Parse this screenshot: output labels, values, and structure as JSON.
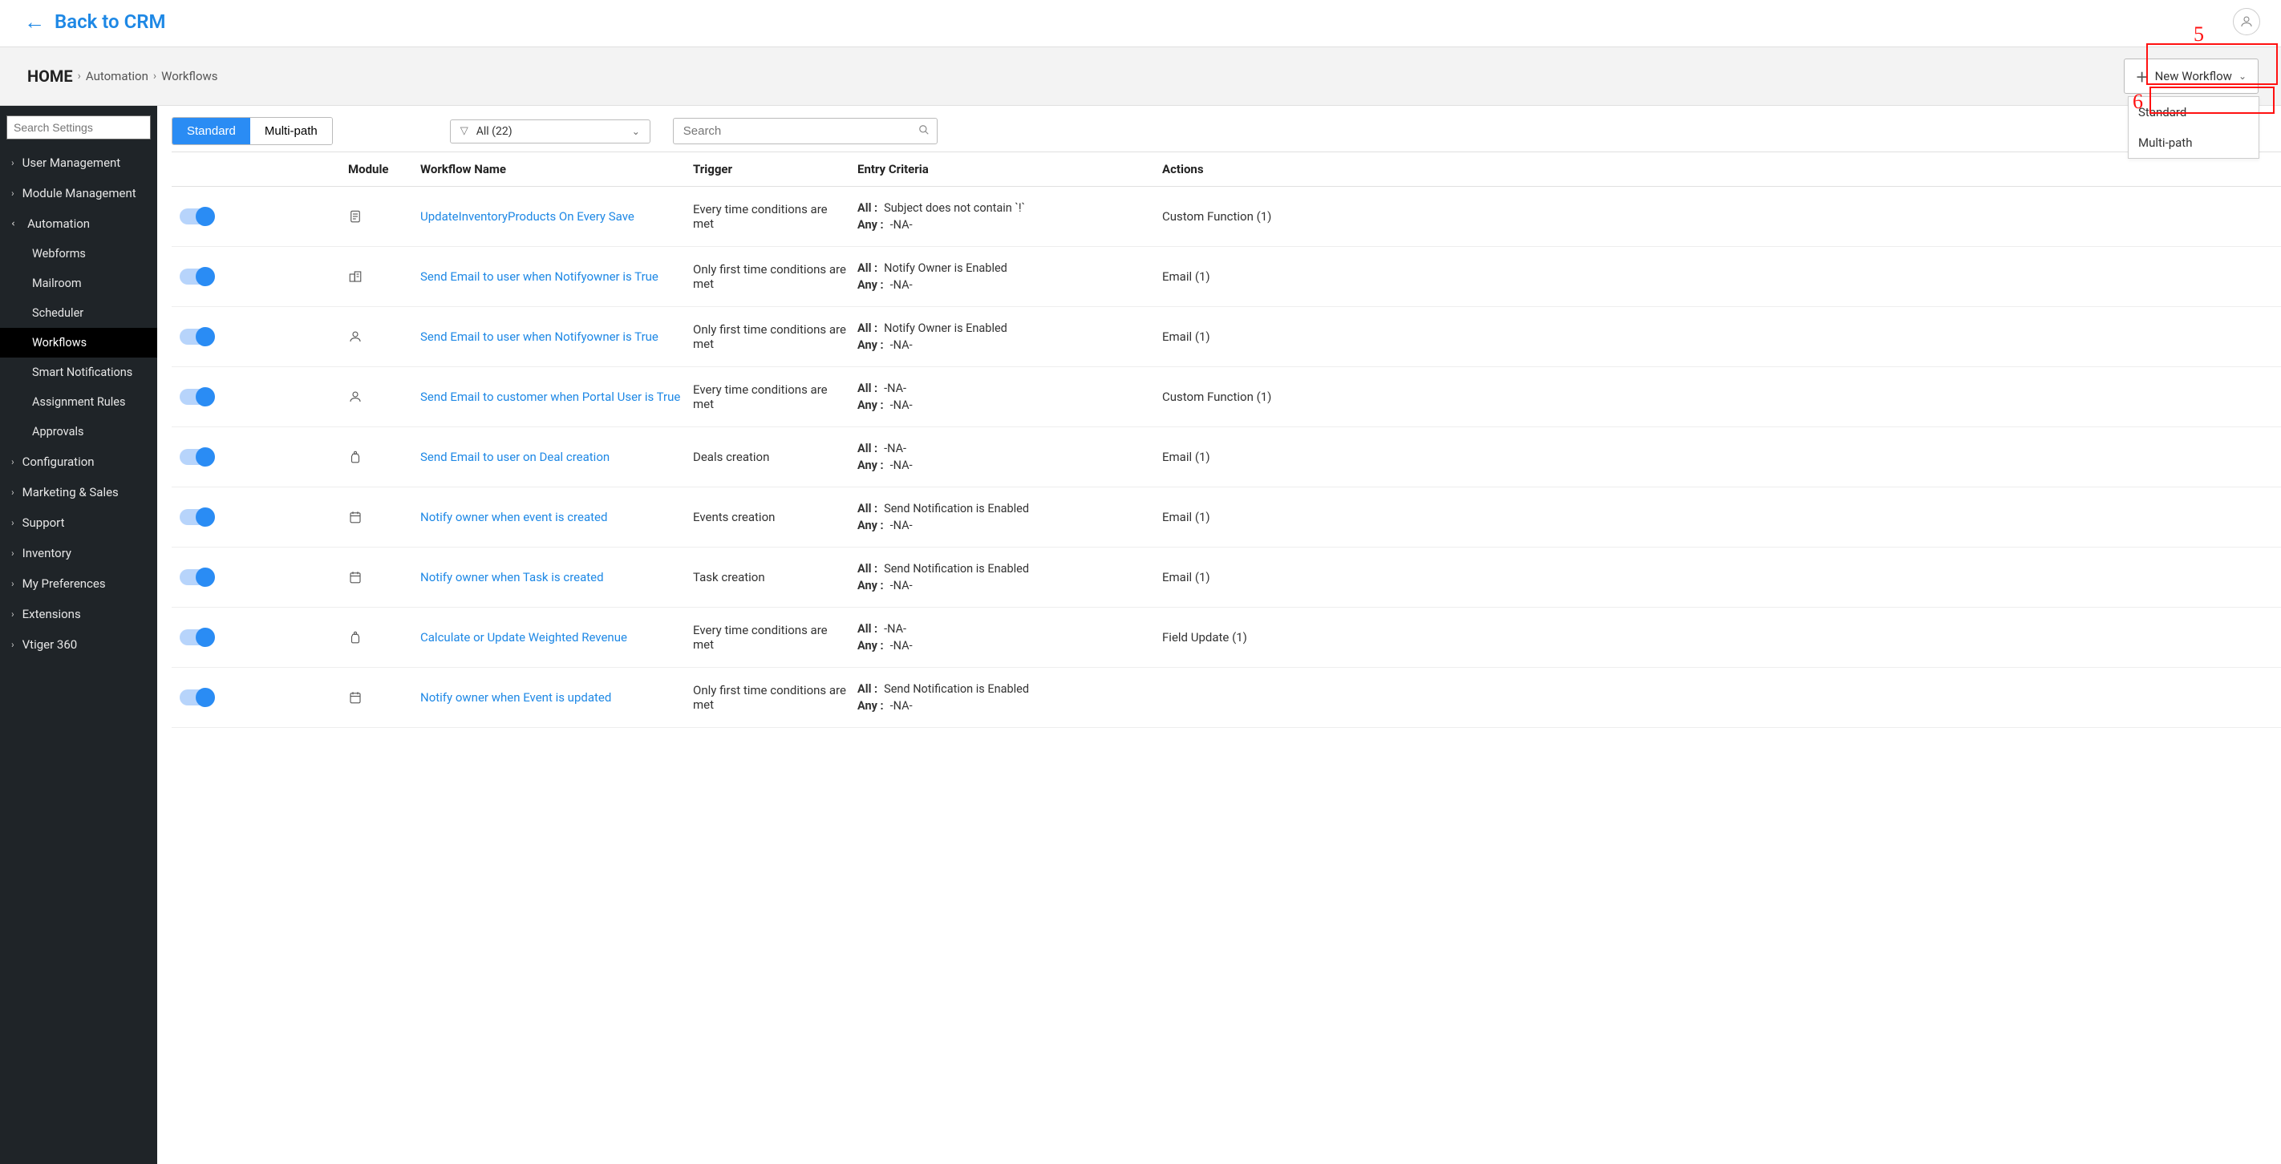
{
  "header": {
    "back_label": "Back to CRM"
  },
  "breadcrumb": {
    "home": "HOME",
    "level1": "Automation",
    "level2": "Workflows"
  },
  "newWorkflow": {
    "label": "New Workflow",
    "menu": {
      "standard": "Standard",
      "multipath": "Multi-path"
    }
  },
  "sidebar": {
    "search_placeholder": "Search Settings",
    "items": [
      {
        "label": "User Management",
        "expanded": false
      },
      {
        "label": "Module Management",
        "expanded": false
      },
      {
        "label": "Automation",
        "expanded": true,
        "children": [
          "Webforms",
          "Mailroom",
          "Scheduler",
          "Workflows",
          "Smart Notifications",
          "Assignment Rules",
          "Approvals"
        ]
      },
      {
        "label": "Configuration",
        "expanded": false
      },
      {
        "label": "Marketing & Sales",
        "expanded": false
      },
      {
        "label": "Support",
        "expanded": false
      },
      {
        "label": "Inventory",
        "expanded": false
      },
      {
        "label": "My Preferences",
        "expanded": false
      },
      {
        "label": "Extensions",
        "expanded": false
      },
      {
        "label": "Vtiger 360",
        "expanded": false
      }
    ],
    "active_child": "Workflows"
  },
  "toolbar": {
    "seg_standard": "Standard",
    "seg_multipath": "Multi-path",
    "filter_label": "All (22)",
    "search_placeholder": "Search"
  },
  "table": {
    "headers": {
      "module": "Module",
      "name": "Workflow Name",
      "trigger": "Trigger",
      "criteria": "Entry Criteria",
      "actions": "Actions"
    },
    "rows": [
      {
        "icon": "doc",
        "name": "UpdateInventoryProducts On Every Save",
        "trigger": "Every time conditions are met",
        "all": "Subject does not contain `!`",
        "any": "-NA-",
        "actions": "Custom Function (1)"
      },
      {
        "icon": "org",
        "name": "Send Email to user when Notifyowner is True",
        "trigger": "Only first time conditions are met",
        "all": "Notify Owner is Enabled",
        "any": "-NA-",
        "actions": "Email (1)"
      },
      {
        "icon": "contact",
        "name": "Send Email to user when Notifyowner is True",
        "trigger": "Only first time conditions are met",
        "all": "Notify Owner is Enabled",
        "any": "-NA-",
        "actions": "Email (1)"
      },
      {
        "icon": "contact",
        "name": "Send Email to customer when Portal User is True",
        "trigger": "Every time conditions are met",
        "all": "-NA-",
        "any": "-NA-",
        "actions": "Custom Function (1)"
      },
      {
        "icon": "deal",
        "name": "Send Email to user on Deal creation",
        "trigger": "Deals creation",
        "all": "-NA-",
        "any": "-NA-",
        "actions": "Email (1)"
      },
      {
        "icon": "calendar",
        "name": "Notify owner when event is created",
        "trigger": "Events creation",
        "all": "Send Notification is Enabled",
        "any": "-NA-",
        "actions": "Email (1)"
      },
      {
        "icon": "calendar",
        "name": "Notify owner when Task is created",
        "trigger": "Task creation",
        "all": "Send Notification is Enabled",
        "any": "-NA-",
        "actions": "Email (1)"
      },
      {
        "icon": "deal",
        "name": "Calculate or Update Weighted Revenue",
        "trigger": "Every time conditions are met",
        "all": "-NA-",
        "any": "-NA-",
        "actions": "Field Update (1)"
      },
      {
        "icon": "calendar",
        "name": "Notify owner when Event is updated",
        "trigger": "Only first time conditions are met",
        "all": "Send Notification is Enabled",
        "any": "-NA-",
        "actions": ""
      }
    ]
  },
  "labels": {
    "all": "All :",
    "any": "Any :"
  },
  "annotations": {
    "five": "5",
    "six": "6"
  }
}
